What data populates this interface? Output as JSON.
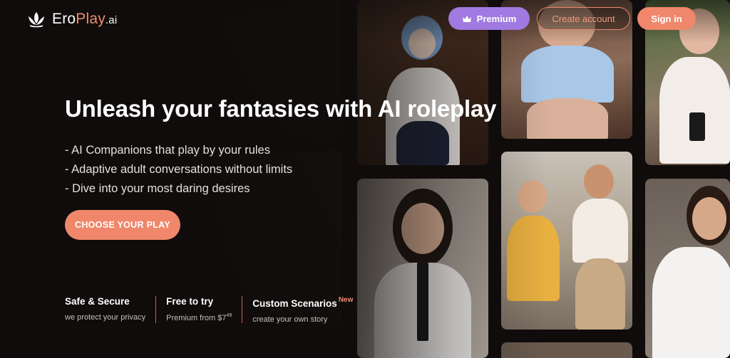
{
  "brand": {
    "name_main": "Ero",
    "name_accent": "Play",
    "name_tld": ".ai"
  },
  "header": {
    "premium_label": "Premium",
    "create_label": "Create account",
    "signin_label": "Sign in"
  },
  "hero": {
    "headline": "Unleash your fantasies with AI roleplay",
    "features": [
      "- AI Companions that play by your rules",
      "- Adaptive adult conversations without limits",
      "- Dive into your most daring desires"
    ],
    "cta_label": "CHOOSE YOUR PLAY"
  },
  "stats": [
    {
      "title": "Safe & Secure",
      "sub": "we protect your privacy"
    },
    {
      "title": "Free to try",
      "sub_prefix": "Premium from $7",
      "sub_sup": "49"
    },
    {
      "title": "Custom Scenarios",
      "badge": "New",
      "sub": "create your own story"
    }
  ],
  "colors": {
    "accent": "#f0876a",
    "premium": "#a07ae0",
    "background": "#0f0c0b"
  }
}
